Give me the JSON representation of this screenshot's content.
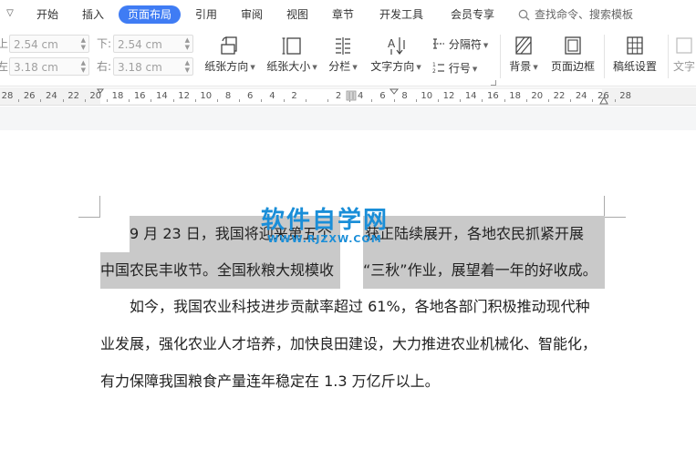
{
  "menu": {
    "tabs": [
      {
        "label": "开始",
        "active": false
      },
      {
        "label": "插入",
        "active": false
      },
      {
        "label": "页面布局",
        "active": true
      },
      {
        "label": "引用",
        "active": false
      },
      {
        "label": "审阅",
        "active": false
      },
      {
        "label": "视图",
        "active": false
      },
      {
        "label": "章节",
        "active": false
      },
      {
        "label": "开发工具",
        "active": false
      },
      {
        "label": "会员专享",
        "active": false
      }
    ],
    "search_label": "查找命令、搜索模板"
  },
  "ribbon": {
    "margins": {
      "top_label": "上:",
      "top_value": "2.54 cm",
      "bottom_label": "下:",
      "bottom_value": "2.54 cm",
      "left_label": "左:",
      "left_value": "3.18 cm",
      "right_label": "右:",
      "right_value": "3.18 cm"
    },
    "paper_orientation": "纸张方向",
    "paper_size": "纸张大小",
    "columns": "分栏",
    "text_direction": "文字方向",
    "separator": "分隔符",
    "line_number": "行号",
    "background": "背景",
    "page_border": "页面边框",
    "manuscript_settings": "稿纸设置",
    "text_partial": "文字"
  },
  "ruler": {
    "numbers": [
      "28",
      "26",
      "24",
      "22",
      "20",
      "18",
      "16",
      "14",
      "12",
      "10",
      "8",
      "6",
      "4",
      "2",
      "",
      "2",
      "4",
      "6",
      "8",
      "10",
      "12",
      "14",
      "16",
      "18",
      "20",
      "22",
      "24",
      "26",
      "28"
    ]
  },
  "watermark": {
    "main": "软件自学网",
    "sub": "WWW.RJZXW.COM"
  },
  "document": {
    "p1_line1_a": "9 月 23 日，我国将迎来第五个",
    "p1_line1_b": "获正陆续展开，各地农民抓紧开展",
    "p1_line2_a": "中国农民丰收节。全国秋粮大规模收",
    "p1_line2_b": "“三秋”作业，展望着一年的好收成。",
    "p2_line1": "如今，我国农业科技进步贡献率超过 61%，各地各部门积极推动现代种",
    "p2_line2": "业发展，强化农业人才培养，加快良田建设，大力推进农业机械化、智能化，",
    "p2_line3": "有力保障我国粮食产量连年稳定在 1.3 万亿斤以上。"
  },
  "colors": {
    "accent": "#3f7cf4",
    "watermark": "#1a8ed8",
    "selection": "#c9c9c9"
  }
}
